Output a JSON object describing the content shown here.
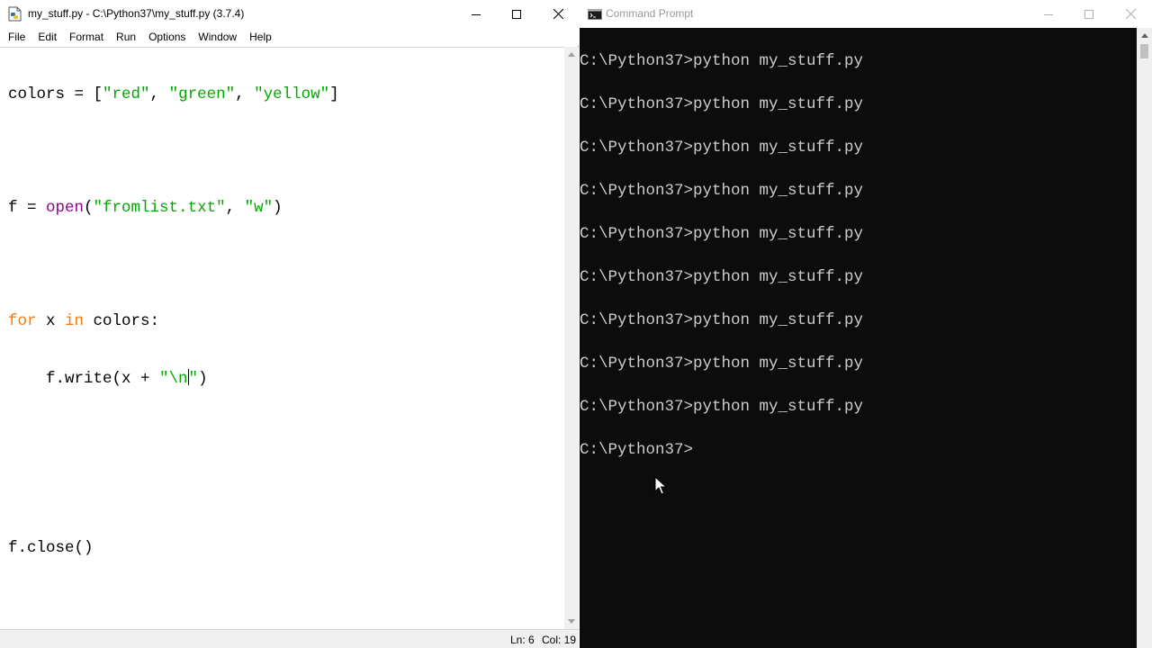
{
  "idle": {
    "title": "my_stuff.py - C:\\Python37\\my_stuff.py (3.7.4)",
    "menu": [
      "File",
      "Edit",
      "Format",
      "Run",
      "Options",
      "Window",
      "Help"
    ],
    "code": {
      "l1": {
        "a": "colors = [",
        "b": "\"red\"",
        "c": ", ",
        "d": "\"green\"",
        "e": ", ",
        "f": "\"yellow\"",
        "g": "]"
      },
      "l3": {
        "a": "f = ",
        "b": "open",
        "c": "(",
        "d": "\"fromlist.txt\"",
        "e": ", ",
        "f": "\"w\"",
        "g": ")"
      },
      "l5": {
        "a": "for",
        "b": " x ",
        "c": "in",
        "d": " colors:"
      },
      "l6": {
        "a": "    f.write(x + ",
        "b": "\"\\n",
        "c": "\"",
        "d": ")"
      },
      "l9": {
        "a": "f.close()"
      }
    },
    "status": {
      "line": "Ln: 6",
      "col": "Col: 19"
    },
    "colors": {
      "keyword": "#ff7700",
      "builtin": "#900090",
      "string": "#00aa00"
    }
  },
  "cmd": {
    "title": "Command Prompt",
    "lines": [
      "C:\\Python37>python my_stuff.py",
      "C:\\Python37>python my_stuff.py",
      "C:\\Python37>python my_stuff.py",
      "C:\\Python37>python my_stuff.py",
      "C:\\Python37>python my_stuff.py",
      "C:\\Python37>python my_stuff.py",
      "C:\\Python37>python my_stuff.py",
      "C:\\Python37>python my_stuff.py",
      "C:\\Python37>python my_stuff.py",
      "C:\\Python37>"
    ],
    "colors": {
      "background": "#0c0c0c",
      "text": "#cccccc"
    }
  }
}
